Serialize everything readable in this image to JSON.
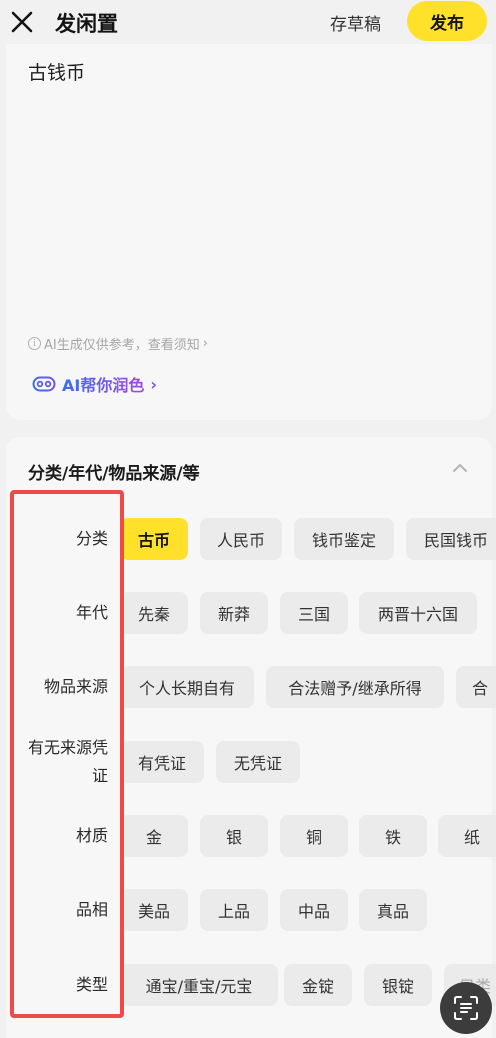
{
  "header": {
    "title": "发闲置",
    "draft_label": "存草稿",
    "publish_label": "发布"
  },
  "description": {
    "text": "古钱币",
    "ai_note": "AI生成仅供参考，查看须知",
    "ai_note_chevron": "›",
    "ai_polish_label": "AI帮你润色",
    "ai_polish_chevron": "›"
  },
  "attributes": {
    "section_title": "分类/年代/物品来源/等",
    "rows": [
      {
        "label": "分类",
        "options": [
          "古币",
          "人民币",
          "钱币鉴定",
          "民国钱币"
        ],
        "selected": "古币"
      },
      {
        "label": "年代",
        "options": [
          "先秦",
          "新莽",
          "三国",
          "两晋十六国"
        ]
      },
      {
        "label": "物品来源",
        "options": [
          "个人长期自有",
          "合法赠予/继承所得",
          "合"
        ]
      },
      {
        "label_line1": "有无来源凭",
        "label_line2": "证",
        "options": [
          "有凭证",
          "无凭证"
        ]
      },
      {
        "label": "材质",
        "options": [
          "金",
          "银",
          "铜",
          "铁",
          "纸"
        ]
      },
      {
        "label": "品相",
        "options": [
          "美品",
          "上品",
          "中品",
          "真品"
        ]
      },
      {
        "label": "类型",
        "options": [
          "通宝/重宝/元宝",
          "金锭",
          "银锭",
          "目类"
        ]
      }
    ]
  },
  "colors": {
    "accent": "#ffe12b",
    "highlight": "#ee4a4a",
    "ai_gradient_start": "#3a6df0",
    "ai_gradient_end": "#a347e0"
  },
  "icons": {
    "close": "close-icon",
    "info": "info-icon",
    "ai_logo": "ai-logo-icon",
    "collapse": "chevron-up-icon",
    "scan": "scan-text-icon"
  }
}
